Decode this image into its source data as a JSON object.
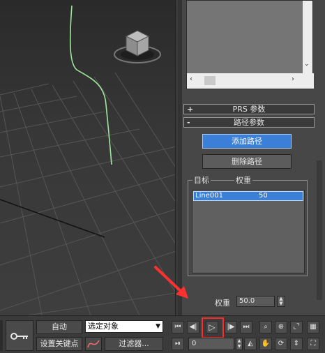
{
  "panel": {
    "rollout_prs": "PRS 参数",
    "rollout_path": "路径参数",
    "add_path_label": "添加路径",
    "delete_path_label": "删除路径",
    "col_target": "目标",
    "col_weight": "权重",
    "targets": [
      {
        "name": "Line001",
        "weight": "50"
      }
    ],
    "weight_label": "权重",
    "weight_value": "50.0"
  },
  "bottom": {
    "auto_label": "自动",
    "set_key_label": "设置关键点",
    "selection_value": "选定对象",
    "filters_label": "过滤器...",
    "frame_value": "0"
  },
  "icons": {
    "key": "key-icon",
    "play": "play-icon",
    "curve": "curve-editor-icon"
  },
  "colors": {
    "highlight": "#ff2a2a",
    "arrow": "#ff3030",
    "selected_row": "#3c7fd6",
    "path_line": "#9fe79a"
  }
}
